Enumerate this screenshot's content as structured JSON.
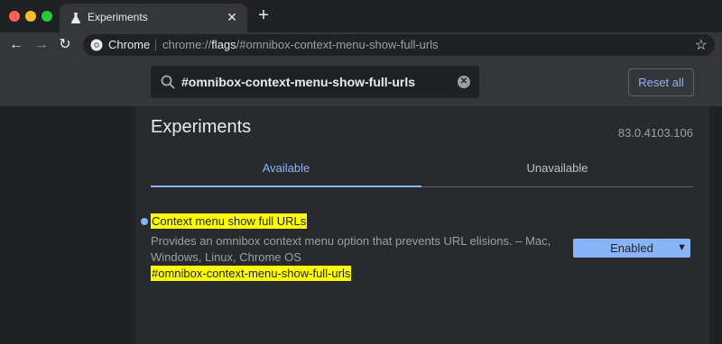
{
  "browser": {
    "tab_title": "Experiments",
    "omnibox_label": "Chrome",
    "url_prefix": "chrome://",
    "url_host": "flags",
    "url_rest": "/#omnibox-context-menu-show-full-urls"
  },
  "search": {
    "value": "#omnibox-context-menu-show-full-urls"
  },
  "header": {
    "reset_label": "Reset all"
  },
  "page": {
    "title": "Experiments",
    "version": "83.0.4103.106",
    "tabs": [
      {
        "label": "Available",
        "active": true
      },
      {
        "label": "Unavailable",
        "active": false
      }
    ]
  },
  "flag": {
    "name": "Context menu show full URLs",
    "description": "Provides an omnibox context menu option that prevents URL elisions. – Mac, Windows, Linux, Chrome OS",
    "link": "#omnibox-context-menu-show-full-urls",
    "selected_option": "Enabled"
  },
  "colors": {
    "accent": "#8ab4f8",
    "highlight": "#ffff00",
    "background": "#202124",
    "surface": "#292a2d"
  },
  "icons": [
    "flask-icon",
    "close-icon",
    "plus-icon",
    "back-arrow-icon",
    "forward-arrow-icon",
    "reload-icon",
    "chrome-logo-icon",
    "star-icon",
    "search-icon",
    "clear-icon",
    "chevron-down-icon"
  ]
}
